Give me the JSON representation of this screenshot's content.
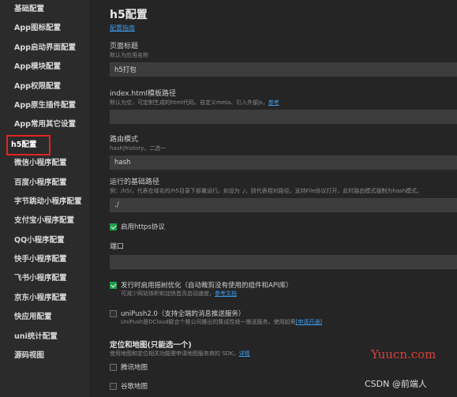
{
  "sidebar": {
    "items": [
      {
        "label": "基础配置"
      },
      {
        "label": "App图标配置"
      },
      {
        "label": "App启动界面配置"
      },
      {
        "label": "App模块配置"
      },
      {
        "label": "App权限配置"
      },
      {
        "label": "App原生插件配置"
      },
      {
        "label": "App常用其它设置"
      },
      {
        "label": "h5配置"
      },
      {
        "label": "微信小程序配置"
      },
      {
        "label": "百度小程序配置"
      },
      {
        "label": "字节跳动小程序配置"
      },
      {
        "label": "支付宝小程序配置"
      },
      {
        "label": "QQ小程序配置"
      },
      {
        "label": "快手小程序配置"
      },
      {
        "label": "飞书小程序配置"
      },
      {
        "label": "京东小程序配置"
      },
      {
        "label": "快应用配置"
      },
      {
        "label": "uni统计配置"
      },
      {
        "label": "源码视图"
      }
    ],
    "active_index": 7,
    "highlight_color": "#e02424"
  },
  "main": {
    "title": "h5配置",
    "guide_link": "配置指南",
    "page_title": {
      "label": "页面标题",
      "desc": "默认为应用名称",
      "value": "h5打包"
    },
    "template": {
      "label": "index.html模板路径",
      "desc": "默认为空，可定制生成的html代码，自定义meta、引入外部js，",
      "link": "参考",
      "value": ""
    },
    "router": {
      "label": "路由模式",
      "desc": "hash|history，二选一",
      "value": "hash"
    },
    "base": {
      "label": "运行的基础路径",
      "desc": "例：/h5/，代表在域名的/h5目录下部署运行。如设为 ./，则代表相对路径，支持File协议打开，此时路由模式强制为hash模式。",
      "value": "./"
    },
    "https": {
      "label": "启用https协议",
      "checked": true
    },
    "port": {
      "label": "端口",
      "value": ""
    },
    "treeshaking": {
      "label": "发行时启用摇树优化（自动裁剪没有使用的组件和API库）",
      "checked": true,
      "desc": "可减少网站体积和加快首页启动速度，",
      "link": "参考文档"
    },
    "unipush": {
      "label": "uniPush2.0（支持全端的消息推送服务）",
      "checked": false,
      "desc": "UniPush是DCloud联合个推公司推出的集成性统一推送服务，使用前需",
      "link": "[申请开通]"
    },
    "maps": {
      "label": "定位和地图(只能选一个)",
      "desc": "使用地图和定位相关功能需申请地图服务商的 SDK。",
      "link": "详情",
      "options": [
        {
          "label": "腾讯地图",
          "checked": false
        },
        {
          "label": "谷歌地图",
          "checked": false
        }
      ]
    }
  },
  "watermark": {
    "site": "Yuucn.com",
    "csdn": "CSDN @前端人"
  }
}
